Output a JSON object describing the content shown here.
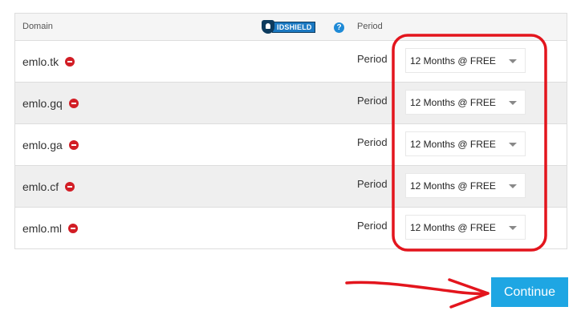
{
  "table": {
    "headers": {
      "domain": "Domain",
      "brand": "IDSHIELD",
      "period": "Period"
    },
    "rows": [
      {
        "domain": "emlo.tk",
        "period_label": "Period",
        "period_value": "12 Months @ FREE"
      },
      {
        "domain": "emlo.gq",
        "period_label": "Period",
        "period_value": "12 Months @ FREE"
      },
      {
        "domain": "emlo.ga",
        "period_label": "Period",
        "period_value": "12 Months @ FREE"
      },
      {
        "domain": "emlo.cf",
        "period_label": "Period",
        "period_value": "12 Months @ FREE"
      },
      {
        "domain": "emlo.ml",
        "period_label": "Period",
        "period_value": "12 Months @ FREE"
      }
    ]
  },
  "help_icon": "?",
  "actions": {
    "continue_label": "Continue"
  },
  "colors": {
    "accent": "#1ea6e3",
    "remove": "#d21d25",
    "annotation": "#e3151d",
    "idshield": "#1b79c2"
  },
  "icons": {
    "remove": "remove-icon",
    "help": "help-icon",
    "brand": "idshield-logo",
    "select": "chevron-down-icon"
  }
}
